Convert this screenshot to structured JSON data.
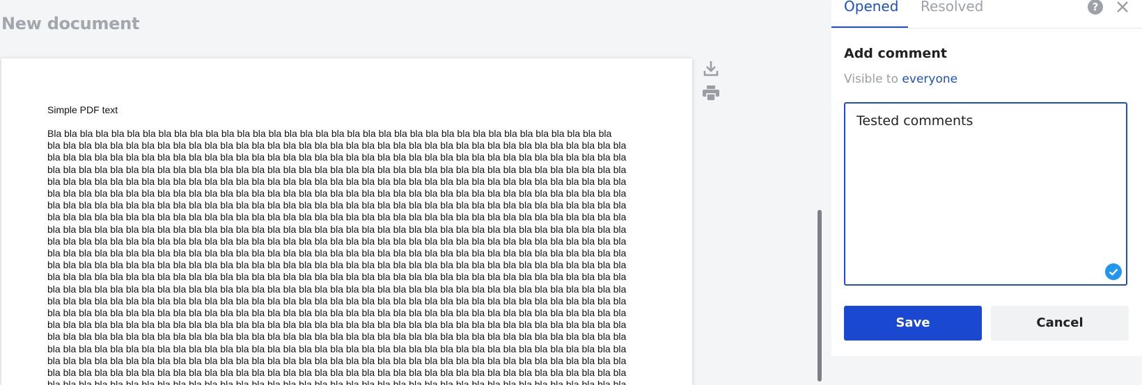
{
  "document": {
    "title": "New document",
    "pdf_heading": "Simple PDF text",
    "body_first_line": "Bla bla bla bla bla bla bla bla bla bla bla bla bla bla bla bla bla bla bla bla bla bla bla bla bla bla bla bla bla bla bla bla bla bla bla bla",
    "body_line": "bla bla bla bla bla bla bla bla bla bla bla bla bla bla bla bla bla bla bla bla bla bla bla bla bla bla bla bla bla bla bla bla bla bla bla bla bla"
  },
  "toolbar": {
    "download_icon": "download-icon",
    "print_icon": "print-icon"
  },
  "panel": {
    "tabs": [
      {
        "label": "Opened",
        "active": true
      },
      {
        "label": "Resolved",
        "active": false
      }
    ],
    "help_label": "?",
    "add_comment_title": "Add comment",
    "visible_prefix": "Visible to",
    "visible_link": "everyone",
    "comment_value": "Tested comments",
    "save_label": "Save",
    "cancel_label": "Cancel"
  },
  "colors": {
    "accent": "#1b4fd0",
    "save_button": "#1b48d1",
    "check_badge": "#2196f3"
  }
}
